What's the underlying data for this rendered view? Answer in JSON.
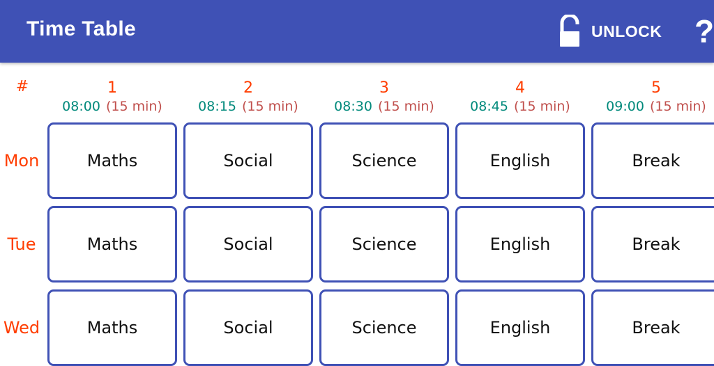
{
  "appbar": {
    "title": "Time Table",
    "unlock_label": "UNLOCK",
    "unlock_icon": "lock-open-icon",
    "help_label": "?",
    "color": "#3f51b5"
  },
  "grid": {
    "corner_label": "#",
    "periods": [
      {
        "number": "1",
        "start": "08:00",
        "duration": "(15 min)"
      },
      {
        "number": "2",
        "start": "08:15",
        "duration": "(15 min)"
      },
      {
        "number": "3",
        "start": "08:30",
        "duration": "(15 min)"
      },
      {
        "number": "4",
        "start": "08:45",
        "duration": "(15 min)"
      },
      {
        "number": "5",
        "start": "09:00",
        "duration": "(15 min)"
      }
    ],
    "days": [
      {
        "label": "Mon",
        "subjects": [
          "Maths",
          "Social",
          "Science",
          "English",
          "Break"
        ]
      },
      {
        "label": "Tue",
        "subjects": [
          "Maths",
          "Social",
          "Science",
          "English",
          "Break"
        ]
      },
      {
        "label": "Wed",
        "subjects": [
          "Maths",
          "Social",
          "Science",
          "English",
          "Break"
        ]
      }
    ],
    "colors": {
      "header_accent": "#ff3d00",
      "time": "#00897b",
      "duration": "#c0504d",
      "cell_border": "#3f51b5"
    }
  }
}
